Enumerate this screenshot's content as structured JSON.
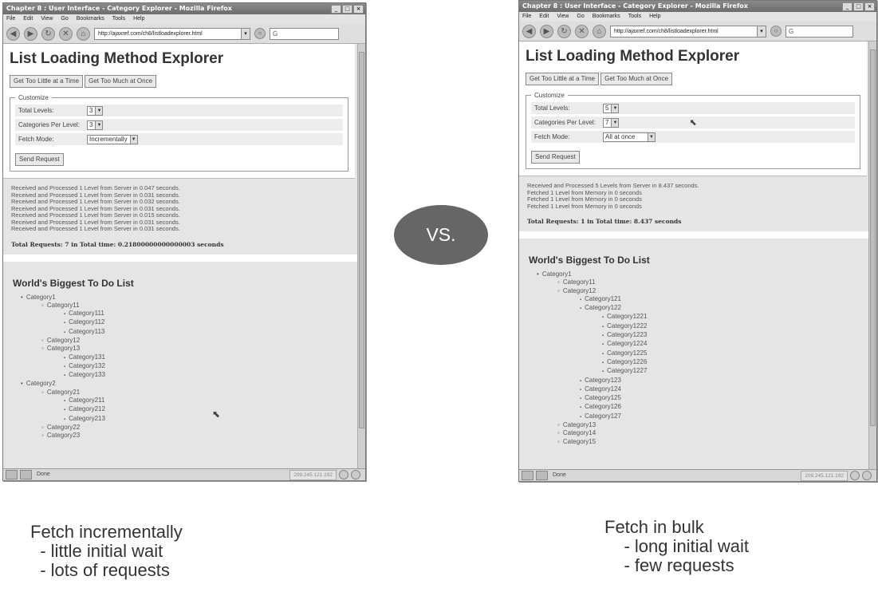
{
  "left": {
    "window_title": "Chapter 8 : User Interface - Category Explorer - Mozilla Firefox",
    "menu": [
      "File",
      "Edit",
      "View",
      "Go",
      "Bookmarks",
      "Tools",
      "Help"
    ],
    "url": "http://ajaxref.com/ch8/listloadexplorer.html",
    "page_title": "List Loading Method Explorer",
    "btn_little": "Get Too Little at a Time",
    "btn_much": "Get Too Much at Once",
    "legend": "Customize",
    "lbl_levels": "Total Levels:",
    "val_levels": "3",
    "lbl_cats": "Categories Per Level:",
    "val_cats": "3",
    "lbl_mode": "Fetch Mode:",
    "val_mode": "Incrementally",
    "send": "Send Request",
    "log": [
      "Received and Processed 1 Level from Server in 0.047 seconds.",
      "Received and Processed 1 Level from Server in 0.031 seconds.",
      "Received and Processed 1 Level from Server in 0.032 seconds.",
      "Received and Processed 1 Level from Server in 0.031 seconds.",
      "Received and Processed 1 Level from Server in 0.015 seconds.",
      "Received and Processed 1 Level from Server in 0.031 seconds.",
      "Received and Processed 1 Level from Server in 0.031 seconds."
    ],
    "total": "Total Requests: 7 in Total time: 0.21800000000000003 seconds",
    "todo_title": "World's Biggest To Do List",
    "tree": [
      {
        "t": "Category1",
        "l": 1
      },
      {
        "t": "Category11",
        "l": 2
      },
      {
        "t": "Category111",
        "l": 3
      },
      {
        "t": "Category112",
        "l": 3
      },
      {
        "t": "Category113",
        "l": 3
      },
      {
        "t": "Category12",
        "l": 2
      },
      {
        "t": "Category13",
        "l": 2
      },
      {
        "t": "Category131",
        "l": 3
      },
      {
        "t": "Category132",
        "l": 3
      },
      {
        "t": "Category133",
        "l": 3
      },
      {
        "t": "Category2",
        "l": 1
      },
      {
        "t": "Category21",
        "l": 2
      },
      {
        "t": "Category211",
        "l": 3
      },
      {
        "t": "Category212",
        "l": 3
      },
      {
        "t": "Category213",
        "l": 3
      },
      {
        "t": "Category22",
        "l": 2
      },
      {
        "t": "Category23",
        "l": 2
      }
    ],
    "status": "Done",
    "ip": "209.245.121.192"
  },
  "right": {
    "window_title": "Chapter 8 : User Interface - Category Explorer - Mozilla Firefox",
    "menu": [
      "File",
      "Edit",
      "View",
      "Go",
      "Bookmarks",
      "Tools",
      "Help"
    ],
    "url": "http://ajaxref.com/ch8/listloadexplorer.html",
    "page_title": "List Loading Method Explorer",
    "btn_little": "Get Too Little at a Time",
    "btn_much": "Get Too Much at Once",
    "legend": "Customize",
    "lbl_levels": "Total Levels:",
    "val_levels": "5",
    "lbl_cats": "Categories Per Level:",
    "val_cats": "7",
    "lbl_mode": "Fetch Mode:",
    "val_mode": "All at once",
    "send": "Send Request",
    "log": [
      "Received and Processed 5 Levels from Server in 8.437 seconds.",
      "Fetched 1 Level from Memory in 0 seconds",
      "Fetched 1 Level from Memory in 0 seconds",
      "Fetched 1 Level from Memory in 0 seconds"
    ],
    "total": "Total Requests: 1 in Total time: 8.437 seconds",
    "todo_title": "World's Biggest To Do List",
    "tree": [
      {
        "t": "Category1",
        "l": 1
      },
      {
        "t": "Category11",
        "l": 2
      },
      {
        "t": "Category12",
        "l": 2
      },
      {
        "t": "Category121",
        "l": 3
      },
      {
        "t": "Category122",
        "l": 3
      },
      {
        "t": "Category1221",
        "l": 4
      },
      {
        "t": "Category1222",
        "l": 4
      },
      {
        "t": "Category1223",
        "l": 4
      },
      {
        "t": "Category1224",
        "l": 4
      },
      {
        "t": "Category1225",
        "l": 4
      },
      {
        "t": "Category1226",
        "l": 4
      },
      {
        "t": "Category1227",
        "l": 4
      },
      {
        "t": "Category123",
        "l": 3
      },
      {
        "t": "Category124",
        "l": 3
      },
      {
        "t": "Category125",
        "l": 3
      },
      {
        "t": "Category126",
        "l": 3
      },
      {
        "t": "Category127",
        "l": 3
      },
      {
        "t": "Category13",
        "l": 2
      },
      {
        "t": "Category14",
        "l": 2
      },
      {
        "t": "Category15",
        "l": 2
      }
    ],
    "status": "Done",
    "ip": "209.245.121.192"
  },
  "vs_label": "VS.",
  "caption_left": "Fetch incrementally\n  - little initial wait\n  - lots of requests",
  "caption_right": "Fetch in bulk\n    - long initial wait\n    - few requests"
}
